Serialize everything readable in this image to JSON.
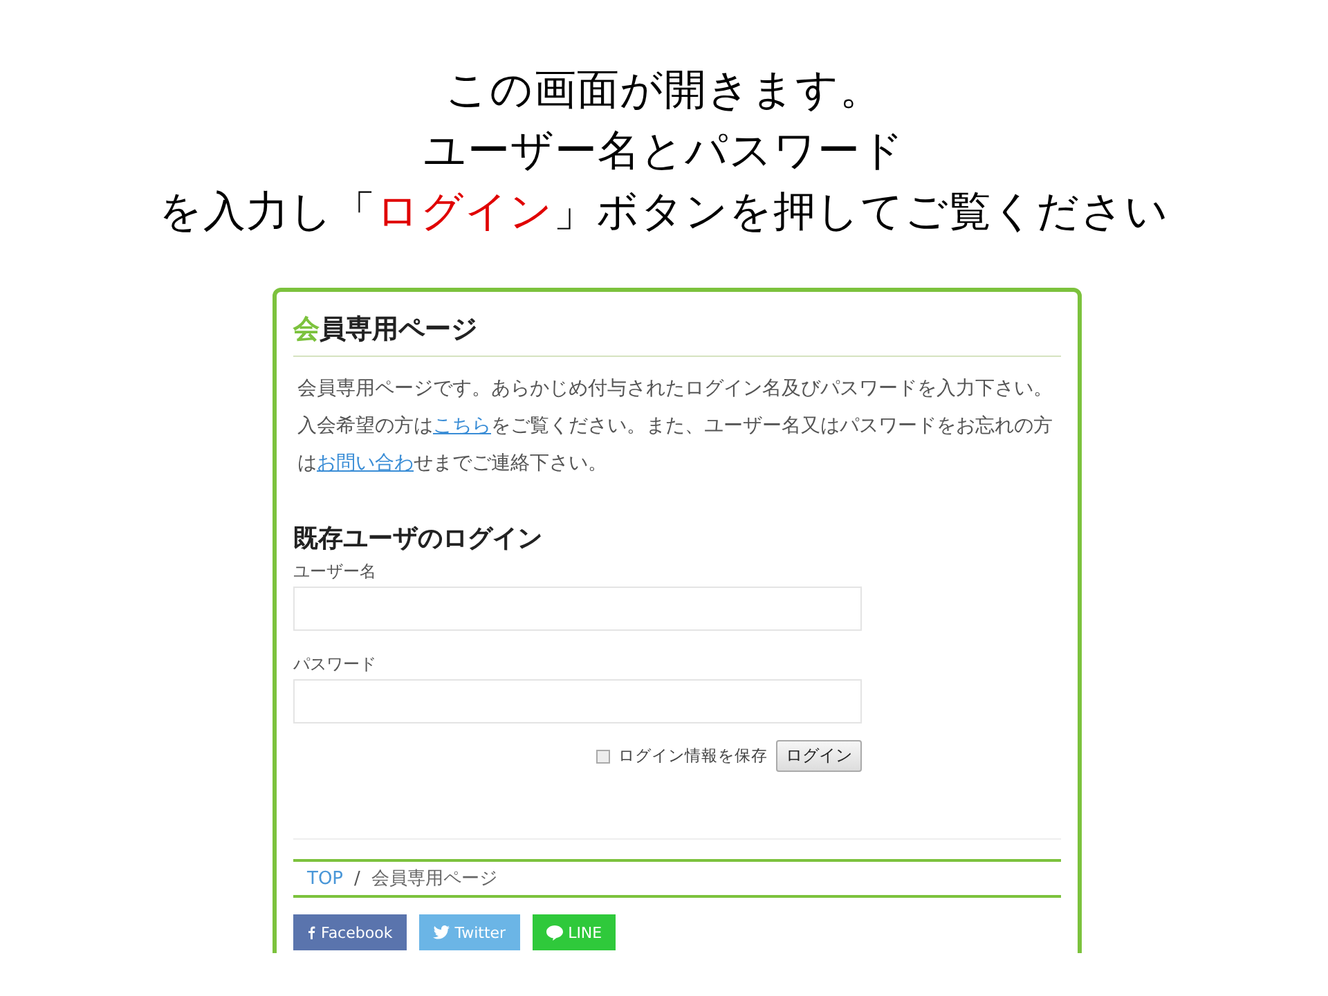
{
  "caption": {
    "lines": [
      [
        {
          "kind": "plain",
          "text": "この画面が開きます。"
        }
      ],
      [
        {
          "kind": "plain",
          "text": "ユーザー名とパスワード"
        }
      ],
      [
        {
          "kind": "plain",
          "text": "を入力し「"
        },
        {
          "kind": "emphasis",
          "text": "ログイン"
        },
        {
          "kind": "plain",
          "text": "」ボタンを押してご覧ください"
        }
      ]
    ]
  },
  "page": {
    "heading": {
      "accent": "会",
      "rest": "員専用ページ"
    },
    "intro": [
      {
        "kind": "text",
        "text": "会員専用ページです。あらかじめ付与されたログイン名及びパスワードを入力下さい。入会希望の方は"
      },
      {
        "kind": "link",
        "text": "こちら"
      },
      {
        "kind": "text",
        "text": "をご覧ください。また、ユーザー名又はパスワードをお忘れの方は"
      },
      {
        "kind": "link",
        "text": "お問い合わ"
      },
      {
        "kind": "text",
        "text": "せまでご連絡下さい。"
      }
    ],
    "login": {
      "title": "既存ユーザのログイン",
      "fields": [
        {
          "label": "ユーザー名"
        },
        {
          "label": "パスワード"
        }
      ],
      "remember": {
        "label": "ログイン情報を保存",
        "checked": false
      },
      "button": "ログイン"
    },
    "breadcrumb": [
      {
        "text": "TOP",
        "kind": "link"
      },
      {
        "text": "/",
        "kind": "separator"
      },
      {
        "text": "会員専用ページ",
        "kind": "current"
      }
    ],
    "share": [
      {
        "kind": "facebook",
        "label": "Facebook"
      },
      {
        "kind": "twitter",
        "label": "Twitter"
      },
      {
        "kind": "line",
        "label": "LINE"
      }
    ]
  }
}
